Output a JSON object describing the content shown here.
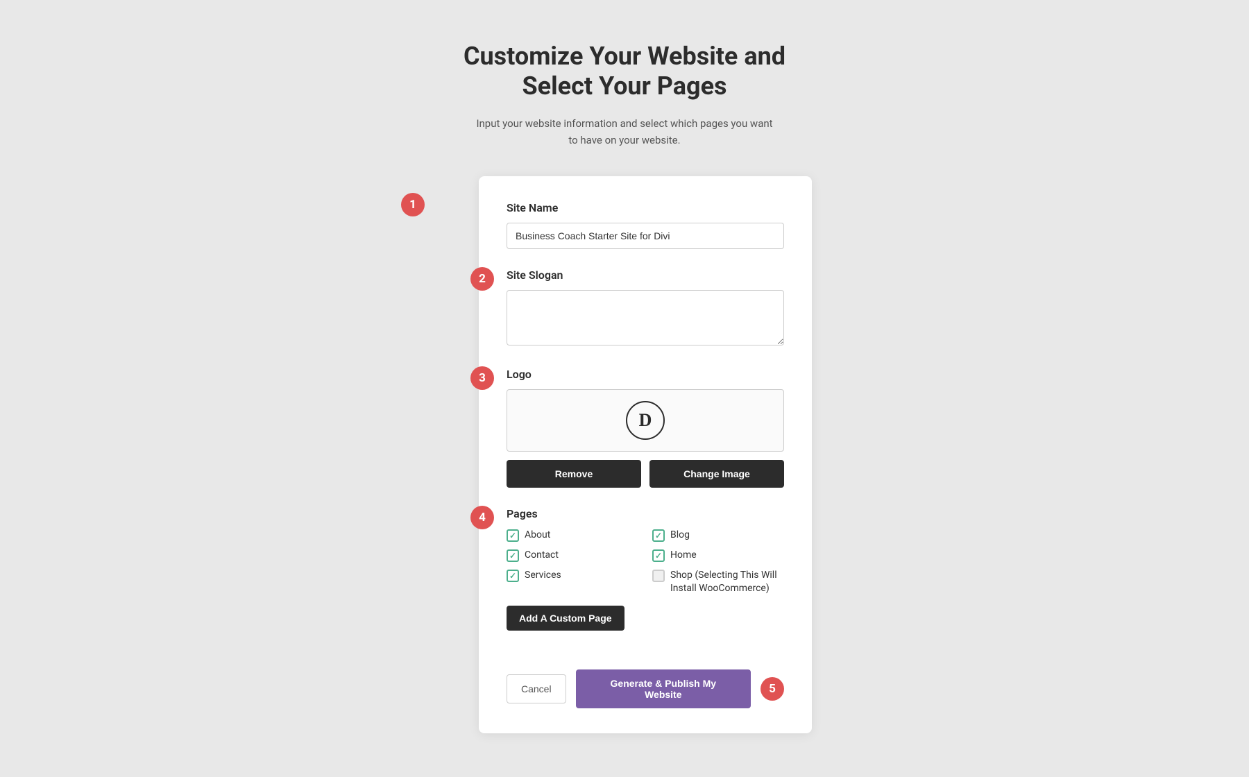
{
  "header": {
    "title_line1": "Customize Your Website and",
    "title_line2": "Select Your Pages",
    "subtitle": "Input your website information and select which pages you want to have on your website."
  },
  "steps": {
    "step1": {
      "number": "1",
      "label": "Site Name"
    },
    "step2": {
      "number": "2",
      "label": "Site Slogan"
    },
    "step3": {
      "number": "3",
      "label": "Logo"
    },
    "step4": {
      "number": "4",
      "label": "Pages"
    },
    "step5": {
      "number": "5"
    }
  },
  "form": {
    "site_name_value": "Business Coach Starter Site for Divi",
    "site_name_placeholder": "Business Coach Starter Site for Divi",
    "site_slogan_placeholder": "",
    "logo_letter": "D"
  },
  "buttons": {
    "remove_label": "Remove",
    "change_image_label": "Change Image",
    "add_custom_page_label": "Add A Custom Page",
    "cancel_label": "Cancel",
    "publish_label": "Generate & Publish My Website"
  },
  "pages": [
    {
      "name": "About",
      "checked": true,
      "col": 1
    },
    {
      "name": "Blog",
      "checked": true,
      "col": 2
    },
    {
      "name": "Contact",
      "checked": true,
      "col": 1
    },
    {
      "name": "Home",
      "checked": true,
      "col": 2
    },
    {
      "name": "Services",
      "checked": true,
      "col": 1
    },
    {
      "name": "Shop (Selecting This Will Install WooCommerce)",
      "checked": false,
      "col": 2
    }
  ]
}
